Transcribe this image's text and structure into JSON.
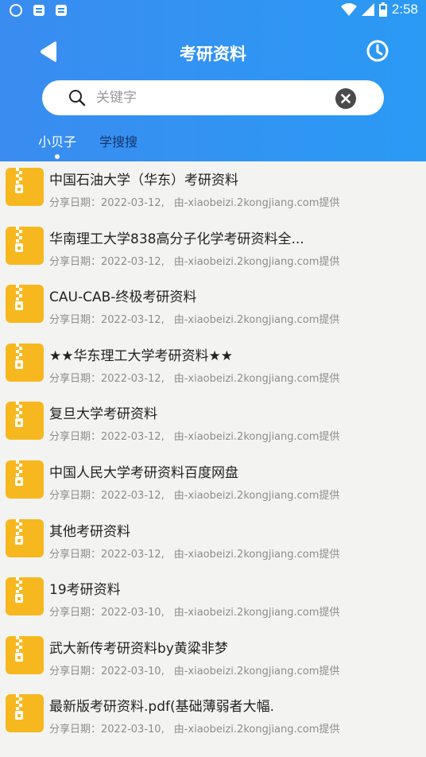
{
  "status_bar": {
    "time": "2:58"
  },
  "header": {
    "title": "考研资料",
    "search": {
      "placeholder": "关键字",
      "value": ""
    },
    "tabs": [
      {
        "label": "小贝子",
        "active": true
      },
      {
        "label": "学搜搜",
        "active": false
      }
    ]
  },
  "colors": {
    "header": "#3a8cf0",
    "zip_icon": "#f7b81f",
    "background": "#f3f4f2"
  },
  "list": {
    "date_prefix": "分享日期：",
    "items": [
      {
        "title": "中国石油大学（华东）考研资料",
        "date": "2022-03-12,",
        "source": "由-xiaobeizi.2kongjiang.com提供"
      },
      {
        "title": "华南理工大学838高分子化学考研资料全...",
        "date": "2022-03-12,",
        "source": "由-xiaobeizi.2kongjiang.com提供"
      },
      {
        "title": "CAU-CAB-终极考研资料",
        "date": "2022-03-12,",
        "source": "由-xiaobeizi.2kongjiang.com提供"
      },
      {
        "title": "★★华东理工大学考研资料★★",
        "date": "2022-03-12,",
        "source": "由-xiaobeizi.2kongjiang.com提供"
      },
      {
        "title": "复旦大学考研资料",
        "date": "2022-03-12,",
        "source": "由-xiaobeizi.2kongjiang.com提供"
      },
      {
        "title": "中国人民大学考研资料百度网盘",
        "date": "2022-03-12,",
        "source": "由-xiaobeizi.2kongjiang.com提供"
      },
      {
        "title": "其他考研资料",
        "date": "2022-03-12,",
        "source": "由-xiaobeizi.2kongjiang.com提供"
      },
      {
        "title": "19考研资料",
        "date": "2022-03-10,",
        "source": "由-xiaobeizi.2kongjiang.com提供"
      },
      {
        "title": "武大新传考研资料by黄粱非梦",
        "date": "2022-03-10,",
        "source": "由-xiaobeizi.2kongjiang.com提供"
      },
      {
        "title": "最新版考研资料.pdf(基础薄弱者大幅.",
        "date": "2022-03-10,",
        "source": "由-xiaobeizi.2kongjiang.com提供"
      }
    ]
  }
}
